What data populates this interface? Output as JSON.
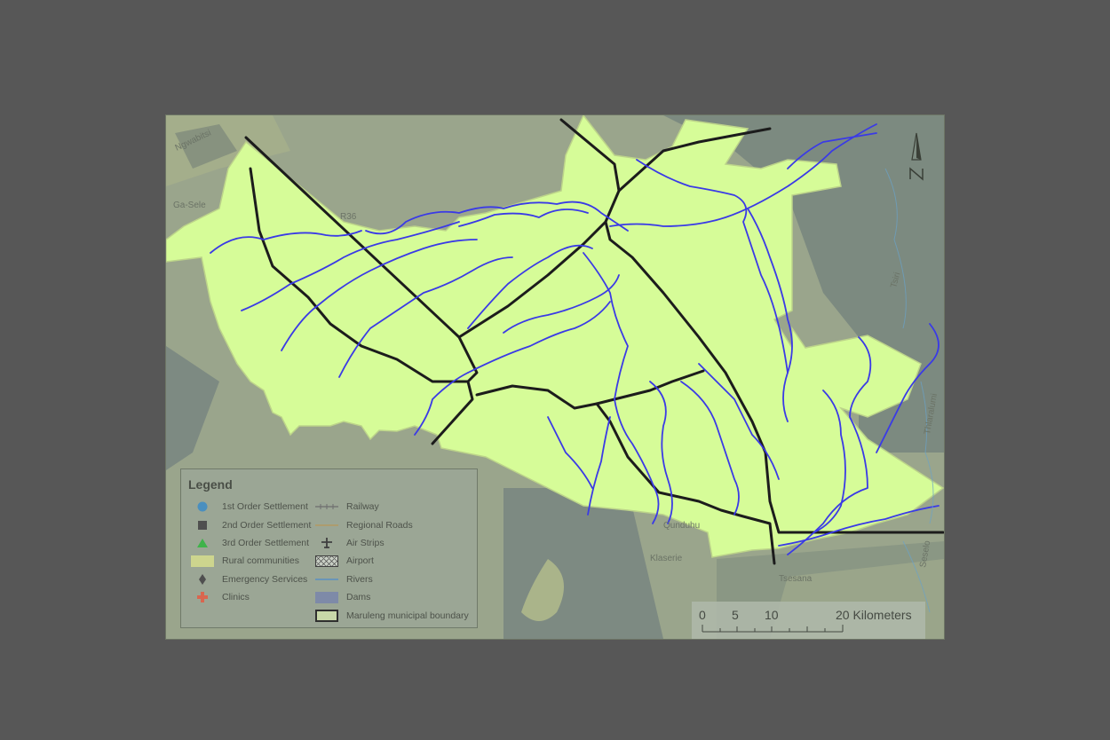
{
  "colors": {
    "page_bg": "#575757",
    "map_bg": "#8f9b86",
    "municipality_fill": "#d6fc98",
    "rivers": "#3a3ae6",
    "roads": "#1c1c1c",
    "dark_area": "#6f7a73"
  },
  "map_labels": {
    "ngwabitsi": "Ngwabitsi",
    "ga_sele": "Ga-Sele",
    "r36": "R36",
    "tsiri": "Tsiri",
    "thlaralumi": "Thlaralumi",
    "qunduhu": "Qunduhu",
    "klaserie": "Klaserie",
    "tsesana": "Tsesana",
    "seselo": "Seselo"
  },
  "north_arrow": {
    "symbol": "N-arrow-icon"
  },
  "legend": {
    "title": "Legend",
    "left_items": [
      {
        "label": "1st Order Settlement",
        "icon": "blue-circle-icon",
        "color": "#4a8fbf"
      },
      {
        "label": "2nd Order Settlement",
        "icon": "dark-square-icon",
        "color": "#4f4f4f"
      },
      {
        "label": "3rd Order Settlement",
        "icon": "green-triangle-icon",
        "color": "#3fb34a"
      },
      {
        "label": "Rural communities",
        "icon": "rural-fill-swatch",
        "color": "#cdd58e"
      },
      {
        "label": "Emergency Services",
        "icon": "diamond-icon",
        "color": "#4f4f4f"
      },
      {
        "label": "Clinics",
        "icon": "red-cross-icon",
        "color": "#d9664f"
      }
    ],
    "right_items": [
      {
        "label": "Railway",
        "icon": "railway-line-icon",
        "color": "#6e6e6e"
      },
      {
        "label": "Regional Roads",
        "icon": "road-line-icon",
        "color": "#b39862"
      },
      {
        "label": "Air Strips",
        "icon": "plane-icon",
        "color": "#3f3f3f"
      },
      {
        "label": "Airport",
        "icon": "hatched-box-icon",
        "color": "#3f3f3f"
      },
      {
        "label": "Rivers",
        "icon": "river-line-icon",
        "color": "#5b8fc4"
      },
      {
        "label": "Dams",
        "icon": "dam-swatch",
        "color": "#7e8aa8"
      },
      {
        "label": "Maruleng municipal boundary",
        "icon": "boundary-swatch",
        "color": "#c8d8a8"
      }
    ]
  },
  "scale_bar": {
    "labels": [
      "0",
      "5",
      "10",
      "20 Kilometers"
    ]
  }
}
